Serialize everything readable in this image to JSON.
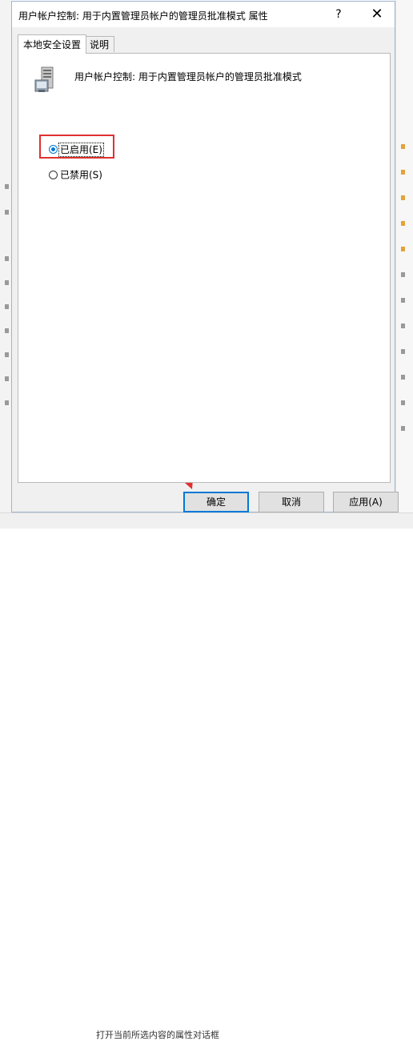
{
  "dialog": {
    "title": "用户帐户控制: 用于内置管理员帐户的管理员批准模式 属性",
    "help_label": "?",
    "close_label": "✕"
  },
  "tabs": [
    {
      "label": "本地安全设置",
      "active": true
    },
    {
      "label": "说明",
      "active": false
    }
  ],
  "policy": {
    "icon": "policy-server-icon",
    "name": "用户帐户控制: 用于内置管理员帐户的管理员批准模式"
  },
  "options": [
    {
      "label": "已启用(E)",
      "checked": true
    },
    {
      "label": "已禁用(S)",
      "checked": false
    }
  ],
  "buttons": {
    "ok": "确定",
    "cancel": "取消",
    "apply": "应用(A)"
  },
  "background": {
    "bottom_text": "打开当前所选内容的属性对话框"
  },
  "colors": {
    "accent": "#0078d7",
    "annotation": "#e03030"
  }
}
